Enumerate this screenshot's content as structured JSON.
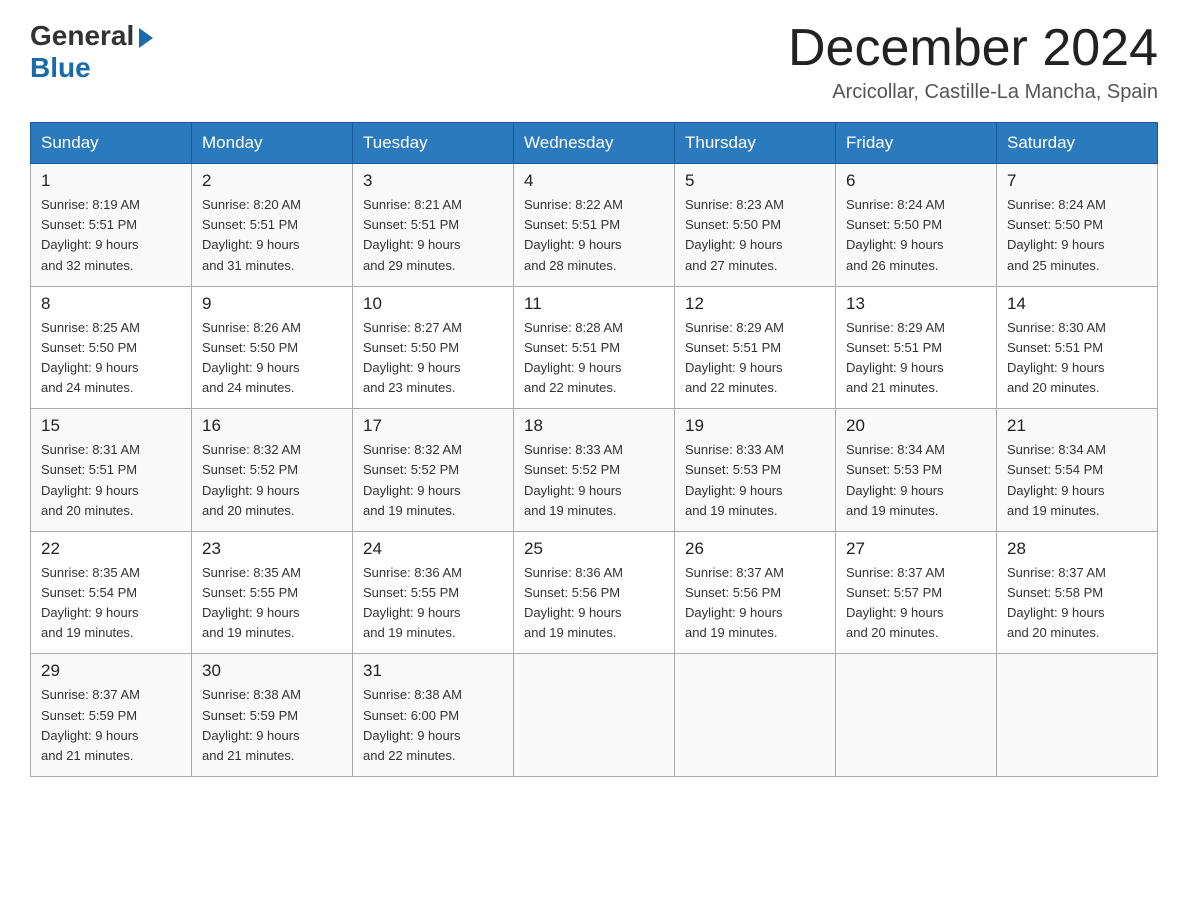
{
  "header": {
    "logo_general": "General",
    "logo_blue": "Blue",
    "month_title": "December 2024",
    "location": "Arcicollar, Castille-La Mancha, Spain"
  },
  "days_of_week": [
    "Sunday",
    "Monday",
    "Tuesday",
    "Wednesday",
    "Thursday",
    "Friday",
    "Saturday"
  ],
  "weeks": [
    [
      {
        "day": "1",
        "sunrise": "8:19 AM",
        "sunset": "5:51 PM",
        "daylight": "9 hours and 32 minutes."
      },
      {
        "day": "2",
        "sunrise": "8:20 AM",
        "sunset": "5:51 PM",
        "daylight": "9 hours and 31 minutes."
      },
      {
        "day": "3",
        "sunrise": "8:21 AM",
        "sunset": "5:51 PM",
        "daylight": "9 hours and 29 minutes."
      },
      {
        "day": "4",
        "sunrise": "8:22 AM",
        "sunset": "5:51 PM",
        "daylight": "9 hours and 28 minutes."
      },
      {
        "day": "5",
        "sunrise": "8:23 AM",
        "sunset": "5:50 PM",
        "daylight": "9 hours and 27 minutes."
      },
      {
        "day": "6",
        "sunrise": "8:24 AM",
        "sunset": "5:50 PM",
        "daylight": "9 hours and 26 minutes."
      },
      {
        "day": "7",
        "sunrise": "8:24 AM",
        "sunset": "5:50 PM",
        "daylight": "9 hours and 25 minutes."
      }
    ],
    [
      {
        "day": "8",
        "sunrise": "8:25 AM",
        "sunset": "5:50 PM",
        "daylight": "9 hours and 24 minutes."
      },
      {
        "day": "9",
        "sunrise": "8:26 AM",
        "sunset": "5:50 PM",
        "daylight": "9 hours and 24 minutes."
      },
      {
        "day": "10",
        "sunrise": "8:27 AM",
        "sunset": "5:50 PM",
        "daylight": "9 hours and 23 minutes."
      },
      {
        "day": "11",
        "sunrise": "8:28 AM",
        "sunset": "5:51 PM",
        "daylight": "9 hours and 22 minutes."
      },
      {
        "day": "12",
        "sunrise": "8:29 AM",
        "sunset": "5:51 PM",
        "daylight": "9 hours and 22 minutes."
      },
      {
        "day": "13",
        "sunrise": "8:29 AM",
        "sunset": "5:51 PM",
        "daylight": "9 hours and 21 minutes."
      },
      {
        "day": "14",
        "sunrise": "8:30 AM",
        "sunset": "5:51 PM",
        "daylight": "9 hours and 20 minutes."
      }
    ],
    [
      {
        "day": "15",
        "sunrise": "8:31 AM",
        "sunset": "5:51 PM",
        "daylight": "9 hours and 20 minutes."
      },
      {
        "day": "16",
        "sunrise": "8:32 AM",
        "sunset": "5:52 PM",
        "daylight": "9 hours and 20 minutes."
      },
      {
        "day": "17",
        "sunrise": "8:32 AM",
        "sunset": "5:52 PM",
        "daylight": "9 hours and 19 minutes."
      },
      {
        "day": "18",
        "sunrise": "8:33 AM",
        "sunset": "5:52 PM",
        "daylight": "9 hours and 19 minutes."
      },
      {
        "day": "19",
        "sunrise": "8:33 AM",
        "sunset": "5:53 PM",
        "daylight": "9 hours and 19 minutes."
      },
      {
        "day": "20",
        "sunrise": "8:34 AM",
        "sunset": "5:53 PM",
        "daylight": "9 hours and 19 minutes."
      },
      {
        "day": "21",
        "sunrise": "8:34 AM",
        "sunset": "5:54 PM",
        "daylight": "9 hours and 19 minutes."
      }
    ],
    [
      {
        "day": "22",
        "sunrise": "8:35 AM",
        "sunset": "5:54 PM",
        "daylight": "9 hours and 19 minutes."
      },
      {
        "day": "23",
        "sunrise": "8:35 AM",
        "sunset": "5:55 PM",
        "daylight": "9 hours and 19 minutes."
      },
      {
        "day": "24",
        "sunrise": "8:36 AM",
        "sunset": "5:55 PM",
        "daylight": "9 hours and 19 minutes."
      },
      {
        "day": "25",
        "sunrise": "8:36 AM",
        "sunset": "5:56 PM",
        "daylight": "9 hours and 19 minutes."
      },
      {
        "day": "26",
        "sunrise": "8:37 AM",
        "sunset": "5:56 PM",
        "daylight": "9 hours and 19 minutes."
      },
      {
        "day": "27",
        "sunrise": "8:37 AM",
        "sunset": "5:57 PM",
        "daylight": "9 hours and 20 minutes."
      },
      {
        "day": "28",
        "sunrise": "8:37 AM",
        "sunset": "5:58 PM",
        "daylight": "9 hours and 20 minutes."
      }
    ],
    [
      {
        "day": "29",
        "sunrise": "8:37 AM",
        "sunset": "5:59 PM",
        "daylight": "9 hours and 21 minutes."
      },
      {
        "day": "30",
        "sunrise": "8:38 AM",
        "sunset": "5:59 PM",
        "daylight": "9 hours and 21 minutes."
      },
      {
        "day": "31",
        "sunrise": "8:38 AM",
        "sunset": "6:00 PM",
        "daylight": "9 hours and 22 minutes."
      },
      null,
      null,
      null,
      null
    ]
  ],
  "labels": {
    "sunrise": "Sunrise:",
    "sunset": "Sunset:",
    "daylight": "Daylight:"
  }
}
